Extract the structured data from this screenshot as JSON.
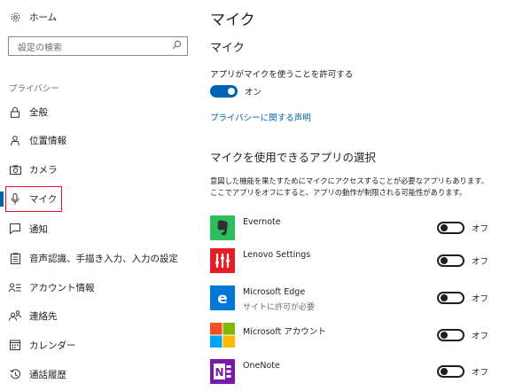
{
  "sidebar": {
    "home_label": "ホーム",
    "search_placeholder": "設定の検索",
    "section_label": "プライバシー",
    "items": [
      {
        "label": "全般",
        "icon": "lock-icon"
      },
      {
        "label": "位置情報",
        "icon": "location-person-icon"
      },
      {
        "label": "カメラ",
        "icon": "camera-icon"
      },
      {
        "label": "マイク",
        "icon": "microphone-icon",
        "active": true
      },
      {
        "label": "通知",
        "icon": "notification-icon"
      },
      {
        "label": "音声認識、手描き入力、入力の設定",
        "icon": "clipboard-icon"
      },
      {
        "label": "アカウント情報",
        "icon": "account-info-icon"
      },
      {
        "label": "連絡先",
        "icon": "contacts-icon"
      },
      {
        "label": "カレンダー",
        "icon": "calendar-icon"
      },
      {
        "label": "通話履歴",
        "icon": "history-icon"
      }
    ]
  },
  "main": {
    "title": "マイク",
    "subtitle": "マイク",
    "allow_label": "アプリがマイクを使うことを許可する",
    "allow_state": "オン",
    "privacy_link": "プライバシーに関する声明",
    "apps_title": "マイクを使用できるアプリの選択",
    "description": "意図した機能を果たすためにマイクにアクセスすることが必要なアプリもあります。ここでアプリをオフにすると、アプリの動作が制限される可能性があります。",
    "apps": [
      {
        "name": "Evernote",
        "sub": "",
        "state": "オフ",
        "icon": "evernote-icon"
      },
      {
        "name": "Lenovo Settings",
        "sub": "",
        "state": "オフ",
        "icon": "lenovo-settings-icon"
      },
      {
        "name": "Microsoft Edge",
        "sub": "サイトに許可が必要",
        "state": "オフ",
        "icon": "edge-icon"
      },
      {
        "name": "Microsoft アカウント",
        "sub": "",
        "state": "オフ",
        "icon": "microsoft-account-icon"
      },
      {
        "name": "OneNote",
        "sub": "",
        "state": "オフ",
        "icon": "onenote-icon"
      }
    ]
  },
  "colors": {
    "accent": "#0063b1",
    "highlight_box": "#e81123",
    "evernote": "#2dbe60",
    "lenovo": "#e31e24",
    "edge": "#0078d7",
    "onenote": "#7719aa"
  }
}
